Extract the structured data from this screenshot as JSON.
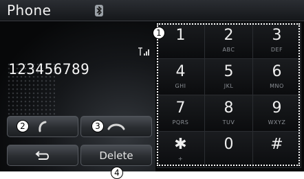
{
  "header": {
    "title": "Phone",
    "bluetooth_icon": "bluetooth-icon"
  },
  "display": {
    "number": "123456789",
    "signal_icon": "signal-strength-icon"
  },
  "buttons": {
    "call_icon": "call-handset-icon",
    "end_icon": "end-call-icon",
    "back_icon": "back-arrow-icon",
    "delete_label": "Delete"
  },
  "keypad": [
    {
      "digit": "1",
      "letters": ""
    },
    {
      "digit": "2",
      "letters": "ABC"
    },
    {
      "digit": "3",
      "letters": "DEF"
    },
    {
      "digit": "4",
      "letters": "GHI"
    },
    {
      "digit": "5",
      "letters": "JKL"
    },
    {
      "digit": "6",
      "letters": "MNO"
    },
    {
      "digit": "7",
      "letters": "PQRS"
    },
    {
      "digit": "8",
      "letters": "TUV"
    },
    {
      "digit": "9",
      "letters": "WXYZ"
    },
    {
      "digit": "✱",
      "letters": "+"
    },
    {
      "digit": "0",
      "letters": ""
    },
    {
      "digit": "#",
      "letters": ""
    }
  ],
  "markers": {
    "keypad": "1",
    "call": "2",
    "end": "3",
    "delete": "4"
  }
}
